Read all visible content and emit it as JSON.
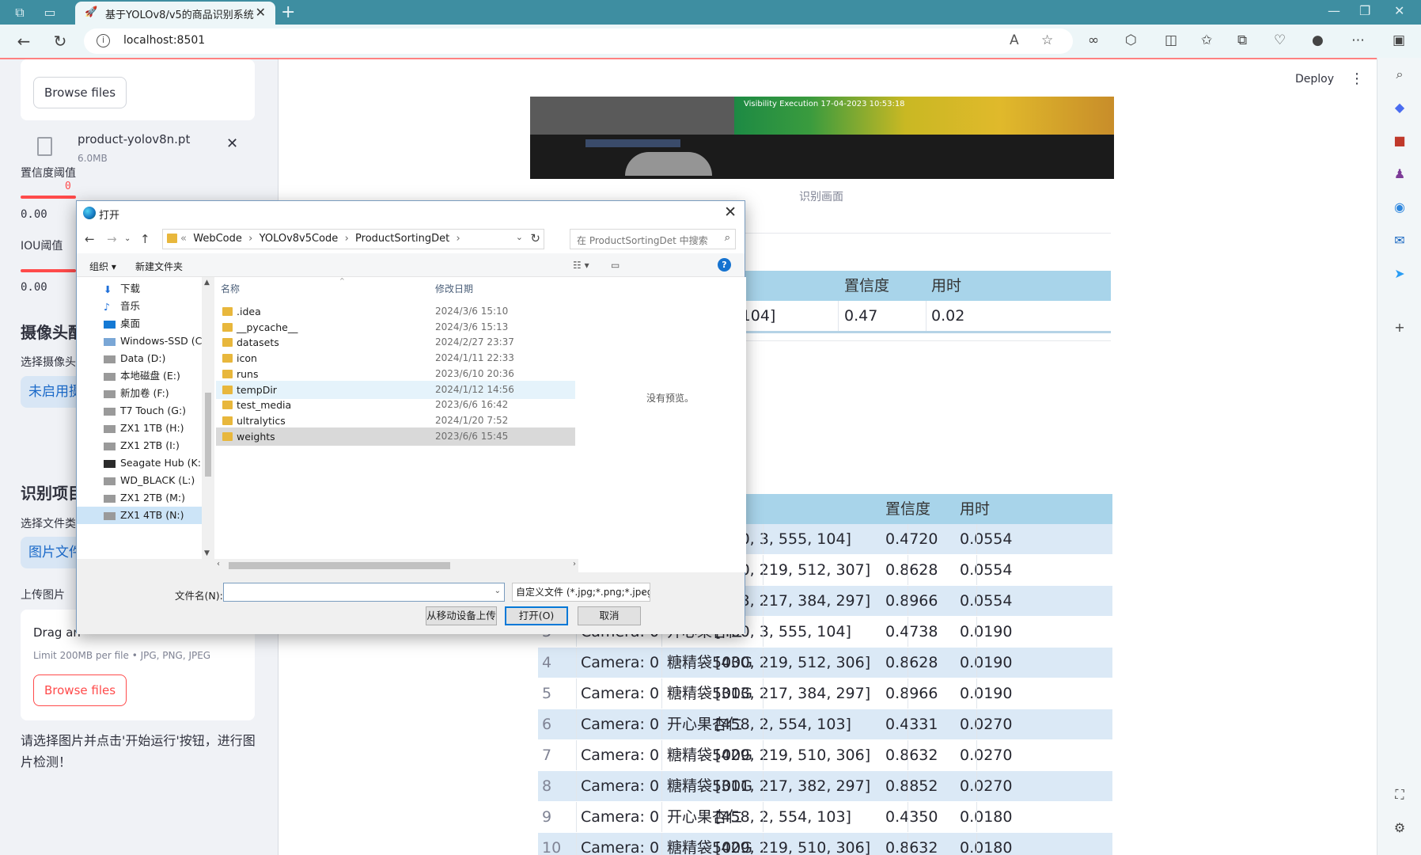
{
  "browser": {
    "tab_title": "基于YOLOv8/v5的商品识别系统",
    "url": "localhost:8501"
  },
  "app": {
    "deploy_label": "Deploy"
  },
  "sidebar": {
    "top_browse_label": "Browse files",
    "model_file": {
      "name": "product-yolov8n.pt",
      "size": "6.0MB"
    },
    "conf_label": "置信度阈值",
    "conf_value": "0.00",
    "conf_marker": "0",
    "iou_label": "IOU阈值",
    "iou_value": "0.00",
    "camera_header": "摄像头配",
    "camera_select_label": "选择摄像头",
    "camera_select_value": "未启用摄",
    "detect_header": "识别项目",
    "file_type_label": "选择文件类",
    "file_type_value": "图片文件",
    "upload_label": "上传图片",
    "drag_text": "Drag an",
    "limit_text": "Limit 200MB per file • JPG, PNG, JPEG",
    "browse_label": "Browse files",
    "note": "请选择图片并点击'开始运行'按钮，进行图片检测！"
  },
  "main": {
    "video_overlay": "Visibility Execution 17-04-2023 10:53:18",
    "caption": "识别画面",
    "result_table": {
      "headers": [
        "置",
        "置信度",
        "用时"
      ],
      "row": [
        "60,3,555,104]",
        "0.47",
        "0.02"
      ]
    },
    "log_table": {
      "headers": [
        "",
        "",
        "",
        "位置",
        "置信度",
        "用时"
      ],
      "rows": [
        [
          "",
          "",
          "仁",
          "[460, 3, 555, 104]",
          "0.4720",
          "0.0554"
        ],
        [
          "",
          "",
          "0G",
          "[430, 219, 512, 307]",
          "0.8628",
          "0.0554"
        ],
        [
          "",
          "",
          "0G",
          "[313, 217, 384, 297]",
          "0.8966",
          "0.0554"
        ],
        [
          "3",
          "Camera: 0",
          "开心果杏仁",
          "[460, 3, 555, 104]",
          "0.4738",
          "0.0190"
        ],
        [
          "4",
          "Camera: 0",
          "糖精袋500G",
          "[430, 219, 512, 306]",
          "0.8628",
          "0.0190"
        ],
        [
          "5",
          "Camera: 0",
          "糖精袋500G",
          "[313, 217, 384, 297]",
          "0.8966",
          "0.0190"
        ],
        [
          "6",
          "Camera: 0",
          "开心果杏仁",
          "[458, 2, 554, 103]",
          "0.4331",
          "0.0270"
        ],
        [
          "7",
          "Camera: 0",
          "糖精袋500G",
          "[429, 219, 510, 306]",
          "0.8632",
          "0.0270"
        ],
        [
          "8",
          "Camera: 0",
          "糖精袋500G",
          "[311, 217, 382, 297]",
          "0.8852",
          "0.0270"
        ],
        [
          "9",
          "Camera: 0",
          "开心果杏仁",
          "[458, 2, 554, 103]",
          "0.4350",
          "0.0180"
        ],
        [
          "10",
          "Camera: 0",
          "糖精袋500G",
          "[429, 219, 510, 306]",
          "0.8632",
          "0.0180"
        ]
      ]
    }
  },
  "dialog": {
    "title": "打开",
    "path": [
      "WebCode",
      "YOLOv8v5Code",
      "ProductSortingDet"
    ],
    "search_placeholder": "在 ProductSortingDet 中搜索",
    "organize": "组织 ▾",
    "new_folder": "新建文件夹",
    "col_name": "名称",
    "col_date": "修改日期",
    "tree": [
      "下载",
      "音乐",
      "桌面",
      "Windows-SSD (C",
      "Data (D:)",
      "本地磁盘 (E:)",
      "新加卷 (F:)",
      "T7 Touch (G:)",
      "ZX1 1TB (H:)",
      "ZX1 2TB (I:)",
      "Seagate Hub (K:",
      "WD_BLACK (L:)",
      "ZX1 2TB (M:)",
      "ZX1 4TB (N:)"
    ],
    "files": [
      {
        "name": ".idea",
        "date": "2024/3/6 15:10"
      },
      {
        "name": "__pycache__",
        "date": "2024/3/6 15:13"
      },
      {
        "name": "datasets",
        "date": "2024/2/27 23:37"
      },
      {
        "name": "icon",
        "date": "2024/1/11 22:33"
      },
      {
        "name": "runs",
        "date": "2023/6/10 20:36"
      },
      {
        "name": "tempDir",
        "date": "2024/1/12 14:56"
      },
      {
        "name": "test_media",
        "date": "2023/6/6 16:42"
      },
      {
        "name": "ultralytics",
        "date": "2024/1/20 7:52"
      },
      {
        "name": "weights",
        "date": "2023/6/6 15:45"
      }
    ],
    "no_preview": "没有预览。",
    "filename_label": "文件名(N):",
    "filename_value": "",
    "filter": "自定义文件 (*.jpg;*.png;*.jpeg",
    "mobile_upload": "从移动设备上传",
    "open_btn": "打开(O)",
    "cancel_btn": "取消"
  }
}
